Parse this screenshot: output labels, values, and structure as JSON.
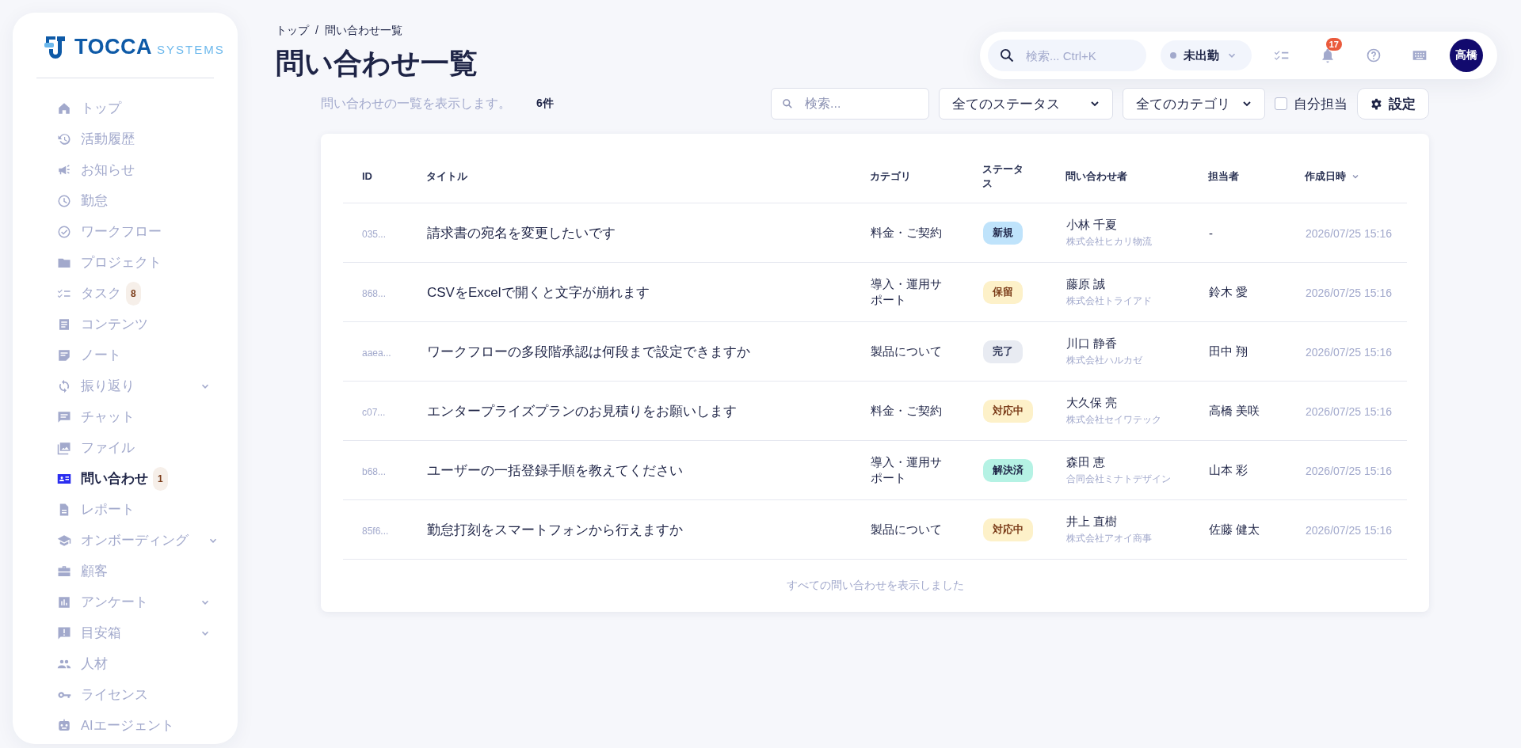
{
  "logo": {
    "name": "TOCCA",
    "suffix": "SYSTEMS"
  },
  "sidebar": {
    "items": [
      {
        "label": "トップ",
        "selected": false,
        "collapsible": false
      },
      {
        "label": "活動履歴",
        "selected": false,
        "collapsible": false
      },
      {
        "label": "お知らせ",
        "selected": false,
        "collapsible": false
      },
      {
        "label": "勤怠",
        "selected": false,
        "collapsible": false
      },
      {
        "label": "ワークフロー",
        "selected": false,
        "collapsible": false
      },
      {
        "label": "プロジェクト",
        "selected": false,
        "collapsible": false
      },
      {
        "label": "タスク",
        "selected": false,
        "collapsible": false,
        "badge": "8"
      },
      {
        "label": "コンテンツ",
        "selected": false,
        "collapsible": false
      },
      {
        "label": "ノート",
        "selected": false,
        "collapsible": false
      },
      {
        "label": "振り返り",
        "selected": false,
        "collapsible": true
      },
      {
        "label": "チャット",
        "selected": false,
        "collapsible": false
      },
      {
        "label": "ファイル",
        "selected": false,
        "collapsible": false
      },
      {
        "label": "問い合わせ",
        "selected": true,
        "collapsible": false,
        "badge": "1"
      },
      {
        "label": "レポート",
        "selected": false,
        "collapsible": false
      },
      {
        "label": "オンボーディング",
        "selected": false,
        "collapsible": true
      },
      {
        "label": "顧客",
        "selected": false,
        "collapsible": false
      },
      {
        "label": "アンケート",
        "selected": false,
        "collapsible": true
      },
      {
        "label": "目安箱",
        "selected": false,
        "collapsible": true
      },
      {
        "label": "人材",
        "selected": false,
        "collapsible": false
      },
      {
        "label": "ライセンス",
        "selected": false,
        "collapsible": false
      },
      {
        "label": "AIエージェント",
        "selected": false,
        "collapsible": false
      }
    ]
  },
  "breadcrumb": [
    "トップ",
    "問い合わせ一覧"
  ],
  "breadcrumb_separator": "/",
  "page_title": "問い合わせ一覧",
  "header": {
    "search": {
      "placeholder": "検索... Ctrl+K"
    },
    "attendance": "未出勤",
    "notification_count": "17",
    "avatar": "高橋"
  },
  "description": "問い合わせの一覧を表示します。",
  "count": "6件",
  "filters": {
    "search": {
      "placeholder": "検索..."
    },
    "status": "全てのステータス",
    "category": "全てのカテゴリ",
    "mine": {
      "label": "自分担当",
      "checked": false
    },
    "settings": "設定"
  },
  "table": {
    "columns": [
      {
        "label": "ID",
        "sorted": false
      },
      {
        "label": "タイトル",
        "sorted": false
      },
      {
        "label": "カテゴリ",
        "sorted": false
      },
      {
        "label": "ステータス",
        "sorted": false
      },
      {
        "label": "問い合わせ者",
        "sorted": false
      },
      {
        "label": "担当者",
        "sorted": false
      },
      {
        "label": "作成日時",
        "sorted": true
      }
    ],
    "rows": [
      {
        "id": "035...",
        "title": "請求書の宛名を変更したいです",
        "category": "料金・ご契約",
        "status": {
          "label": "新規",
          "kind": "new"
        },
        "inquirer": "小林 千夏",
        "company": "株式会社ヒカリ物流",
        "assignee": "-",
        "created": "2026/07/25 15:16"
      },
      {
        "id": "868...",
        "title": "CSVをExcelで開くと文字が崩れます",
        "category": "導入・運用サポート",
        "status": {
          "label": "保留",
          "kind": "hold"
        },
        "inquirer": "藤原 誠",
        "company": "株式会社トライアド",
        "assignee": "鈴木 愛",
        "created": "2026/07/25 15:16"
      },
      {
        "id": "aaea...",
        "title": "ワークフローの多段階承認は何段まで設定できますか",
        "category": "製品について",
        "status": {
          "label": "完了",
          "kind": "done"
        },
        "inquirer": "川口 静香",
        "company": "株式会社ハルカゼ",
        "assignee": "田中 翔",
        "created": "2026/07/25 15:16"
      },
      {
        "id": "c07...",
        "title": "エンタープライズプランのお見積りをお願いします",
        "category": "料金・ご契約",
        "status": {
          "label": "対応中",
          "kind": "progress"
        },
        "inquirer": "大久保 亮",
        "company": "株式会社セイワテック",
        "assignee": "高橋 美咲",
        "created": "2026/07/25 15:16"
      },
      {
        "id": "b68...",
        "title": "ユーザーの一括登録手順を教えてください",
        "category": "導入・運用サポート",
        "status": {
          "label": "解決済",
          "kind": "resolved"
        },
        "inquirer": "森田 恵",
        "company": "合同会社ミナトデザイン",
        "assignee": "山本 彩",
        "created": "2026/07/25 15:16"
      },
      {
        "id": "85f6...",
        "title": "勤怠打刻をスマートフォンから行えますか",
        "category": "製品について",
        "status": {
          "label": "対応中",
          "kind": "progress"
        },
        "inquirer": "井上 直樹",
        "company": "株式会社アオイ商事",
        "assignee": "佐藤 健太",
        "created": "2026/07/25 15:16"
      }
    ],
    "footer": "すべての問い合わせを表示しました"
  }
}
